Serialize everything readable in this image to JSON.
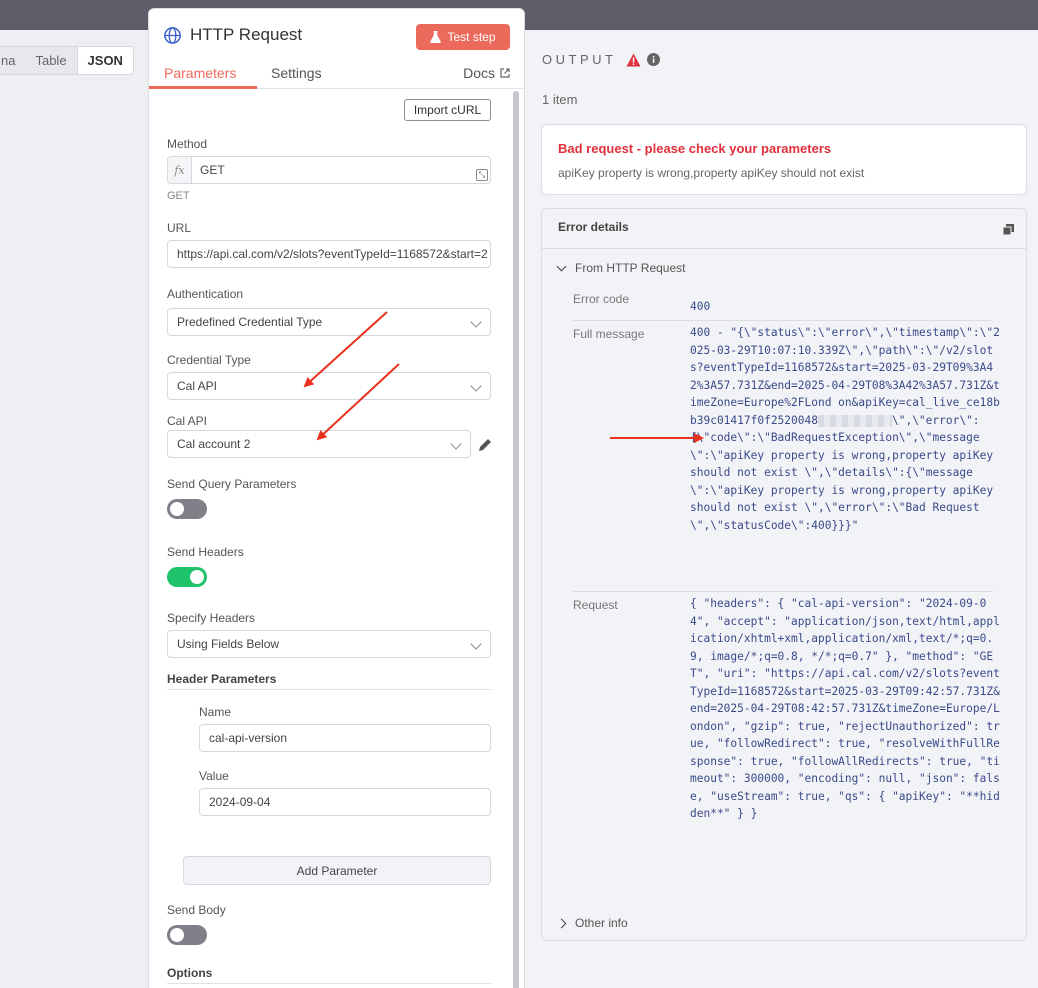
{
  "left_tabs": {
    "schema": "na",
    "table": "Table",
    "json": "JSON"
  },
  "node": {
    "title": "HTTP Request",
    "test_button": "Test step",
    "tabs": {
      "parameters": "Parameters",
      "settings": "Settings",
      "docs": "Docs"
    },
    "import_curl": "Import cURL",
    "method": {
      "label": "Method",
      "value": "GET",
      "hint": "GET",
      "fx": "fx"
    },
    "url": {
      "label": "URL",
      "value": "https://api.cal.com/v2/slots?eventTypeId=1168572&start=2"
    },
    "authentication": {
      "label": "Authentication",
      "value": "Predefined Credential Type"
    },
    "credential_type": {
      "label": "Credential Type",
      "value": "Cal API"
    },
    "cal_api": {
      "label": "Cal API",
      "value": "Cal account 2"
    },
    "send_query": {
      "label": "Send Query Parameters",
      "enabled": false
    },
    "send_headers": {
      "label": "Send Headers",
      "enabled": true
    },
    "specify_headers": {
      "label": "Specify Headers",
      "value": "Using Fields Below"
    },
    "header_params": {
      "label": "Header Parameters",
      "name_label": "Name",
      "name_value": "cal-api-version",
      "value_label": "Value",
      "value_value": "2024-09-04"
    },
    "add_parameter": "Add Parameter",
    "send_body": {
      "label": "Send Body",
      "enabled": false
    },
    "options": "Options"
  },
  "output": {
    "title": "OUTPUT",
    "items": "1 item",
    "error_title": "Bad request - please check your parameters",
    "error_desc": "apiKey property is wrong,property apiKey should not exist",
    "details_title": "Error details",
    "from_section": "From HTTP Request",
    "error_code_label": "Error code",
    "error_code": "400",
    "full_message_label": "Full message",
    "full_message_pre": "400 - \"{\\\"status\\\":\\\"error\\\",\\\"timestamp\\\":\\\"2025-03-29T10:07:10.339Z\\\",\\\"path\\\":\\\"/v2/slots?eventTypeId=1168572&start=2025-03-29T09%3A42%3A57.731Z&end=2025-04-29T08%3A42%3A57.731Z&timeZone=Europe%2FLond on&apiKey=cal_live_ce18bb39c01417f0f2520048",
    "full_message_post": "\\\",\\\"error\\\":{\\\"code\\\":\\\"BadRequestException\\\",\\\"message\\\":\\\"apiKey property is wrong,property apiKey should not exist \\\",\\\"details\\\":{\\\"message\\\":\\\"apiKey property is wrong,property apiKey should not exist \\\",\\\"error\\\":\\\"Bad Request\\\",\\\"statusCode\\\":400}}}\"",
    "request_label": "Request",
    "request": "{ \"headers\": { \"cal-api-version\": \"2024-09-04\", \"accept\": \"application/json,text/html,application/xhtml+xml,application/xml,text/*;q=0.9, image/*;q=0.8, */*;q=0.7\" }, \"method\": \"GET\", \"uri\": \"https://api.cal.com/v2/slots?eventTypeId=1168572&start=2025-03-29T09:42:57.731Z&end=2025-04-29T08:42:57.731Z&timeZone=Europe/London\", \"gzip\": true, \"rejectUnauthorized\": true, \"followRedirect\": true, \"resolveWithFullResponse\": true, \"followAllRedirects\": true, \"timeout\": 300000, \"encoding\": null, \"json\": false, \"useStream\": true, \"qs\": { \"apiKey\": \"**hidden**\" } }",
    "other_info": "Other info"
  },
  "colors": {
    "accent": "#ec6a5b",
    "error": "#e0303c",
    "toggle_on": "#1fc36b",
    "mono_text": "#3a4a8a"
  }
}
